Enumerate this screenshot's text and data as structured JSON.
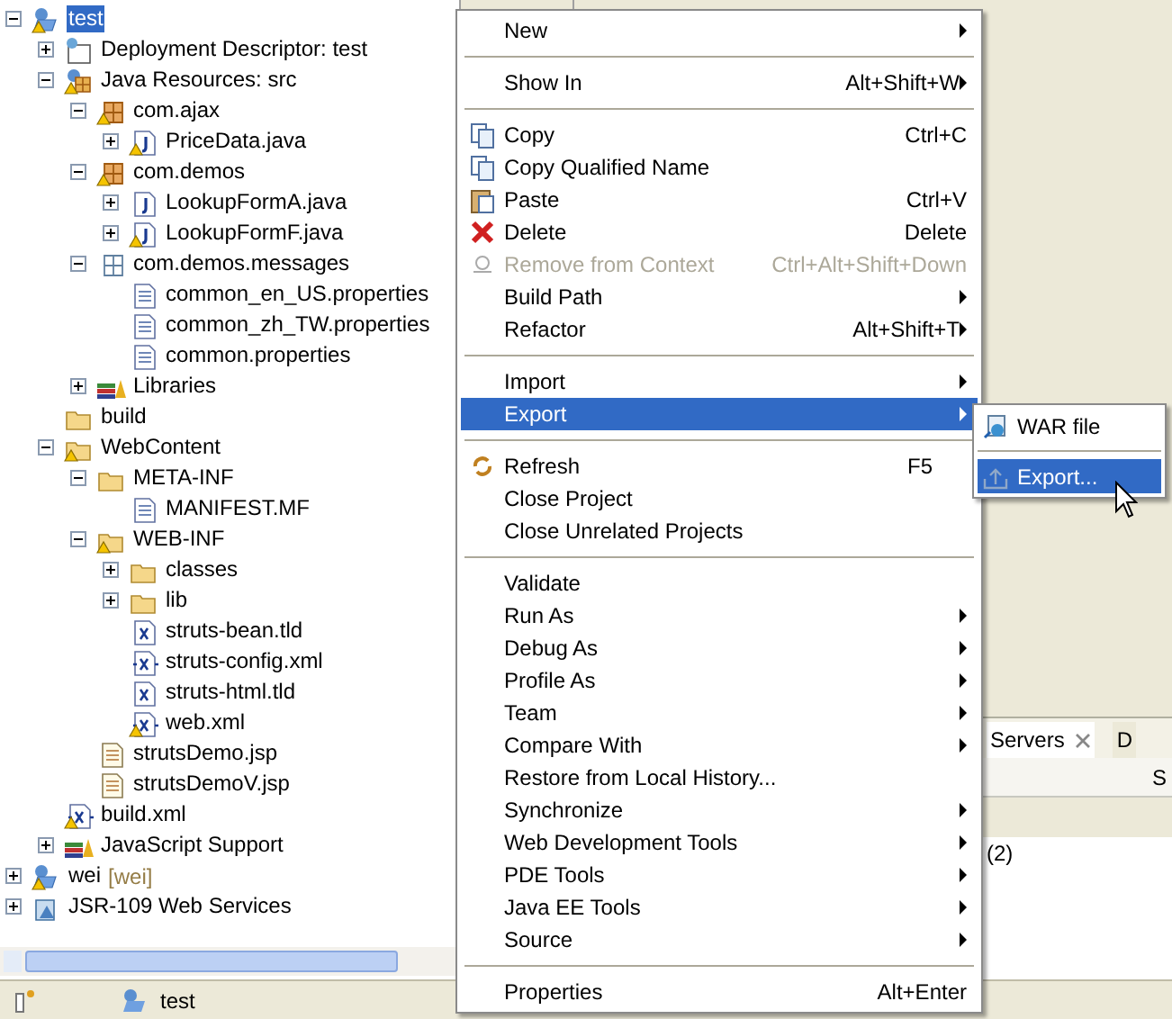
{
  "tree": [
    {
      "label": "test",
      "kind": "project",
      "warning": true,
      "selected": true,
      "expanded": true,
      "children": [
        {
          "label": "Deployment Descriptor: test",
          "kind": "descriptor",
          "warning": false,
          "selected": false,
          "expanded": false
        },
        {
          "label": "Java Resources: src",
          "kind": "java-resources",
          "warning": true,
          "selected": false,
          "expanded": true,
          "children": [
            {
              "label": "com.ajax",
              "kind": "package",
              "warning": true,
              "selected": false,
              "expanded": true,
              "children": [
                {
                  "label": "PriceData.java",
                  "kind": "java-file",
                  "warning": true,
                  "selected": false,
                  "expanded": false
                }
              ]
            },
            {
              "label": "com.demos",
              "kind": "package",
              "warning": true,
              "selected": false,
              "expanded": true,
              "children": [
                {
                  "label": "LookupFormA.java",
                  "kind": "java-file",
                  "warning": false,
                  "selected": false,
                  "expanded": false
                },
                {
                  "label": "LookupFormF.java",
                  "kind": "java-file",
                  "warning": true,
                  "selected": false,
                  "expanded": false
                }
              ]
            },
            {
              "label": "com.demos.messages",
              "kind": "empty-package",
              "warning": false,
              "selected": false,
              "expanded": true,
              "children": [
                {
                  "label": "common_en_US.properties",
                  "kind": "text-file",
                  "warning": false,
                  "selected": false
                },
                {
                  "label": "common_zh_TW.properties",
                  "kind": "text-file",
                  "warning": false,
                  "selected": false
                },
                {
                  "label": "common.properties",
                  "kind": "text-file",
                  "warning": false,
                  "selected": false
                }
              ]
            },
            {
              "label": "Libraries",
              "kind": "library",
              "warning": false,
              "selected": false,
              "expanded": false
            }
          ]
        },
        {
          "label": "build",
          "kind": "folder",
          "warning": false,
          "selected": false
        },
        {
          "label": "WebContent",
          "kind": "folder",
          "warning": true,
          "selected": false,
          "expanded": true,
          "children": [
            {
              "label": "META-INF",
              "kind": "folder",
              "warning": false,
              "selected": false,
              "expanded": true,
              "children": [
                {
                  "label": "MANIFEST.MF",
                  "kind": "text-file",
                  "warning": false,
                  "selected": false
                }
              ]
            },
            {
              "label": "WEB-INF",
              "kind": "folder",
              "warning": true,
              "selected": false,
              "expanded": true,
              "children": [
                {
                  "label": "classes",
                  "kind": "folder",
                  "warning": false,
                  "selected": false,
                  "expanded": false
                },
                {
                  "label": "lib",
                  "kind": "folder",
                  "warning": false,
                  "selected": false,
                  "expanded": false
                },
                {
                  "label": "struts-bean.tld",
                  "kind": "tld-file",
                  "warning": false,
                  "selected": false
                },
                {
                  "label": "struts-config.xml",
                  "kind": "xml-file",
                  "warning": false,
                  "selected": false
                },
                {
                  "label": "struts-html.tld",
                  "kind": "tld-file",
                  "warning": false,
                  "selected": false
                },
                {
                  "label": "web.xml",
                  "kind": "xml-file",
                  "warning": true,
                  "selected": false
                }
              ]
            },
            {
              "label": "strutsDemo.jsp",
              "kind": "jsp-file",
              "warning": false,
              "selected": false
            },
            {
              "label": "strutsDemoV.jsp",
              "kind": "jsp-file",
              "warning": false,
              "selected": false
            }
          ]
        },
        {
          "label": "build.xml",
          "kind": "xml-file",
          "warning": true,
          "selected": false
        },
        {
          "label": "JavaScript Support",
          "kind": "library",
          "warning": false,
          "selected": false,
          "expanded": false
        }
      ]
    },
    {
      "label": "wei",
      "decoration": "[wei]",
      "kind": "project",
      "warning": true,
      "selected": false,
      "expanded": false
    },
    {
      "label": "JSR-109 Web Services",
      "kind": "web-services",
      "warning": false,
      "selected": false,
      "expanded": false
    }
  ],
  "status_bar": {
    "label": "test"
  },
  "servers_panel": {
    "tabs": [
      {
        "label": "Servers",
        "selected": true
      },
      {
        "label": "D",
        "selected": false
      }
    ],
    "column_header": "S",
    "row_text": "(2)"
  },
  "menu": [
    {
      "kind": "item",
      "label": "New",
      "submenu": true,
      "disabled": false,
      "selected": false
    },
    {
      "kind": "separator"
    },
    {
      "kind": "item",
      "label": "Show In",
      "shortcut": "Alt+Shift+W",
      "submenu": true,
      "disabled": false,
      "selected": false
    },
    {
      "kind": "separator"
    },
    {
      "kind": "copy",
      "label": "Copy",
      "shortcut": "Ctrl+C",
      "submenu": false,
      "disabled": false,
      "selected": false
    },
    {
      "kind": "copy",
      "label": "Copy Qualified Name",
      "submenu": false,
      "disabled": false,
      "selected": false
    },
    {
      "kind": "paste",
      "label": "Paste",
      "shortcut": "Ctrl+V",
      "submenu": false,
      "disabled": false,
      "selected": false
    },
    {
      "kind": "delete",
      "label": "Delete",
      "shortcut": "Delete",
      "submenu": false,
      "disabled": false,
      "selected": false
    },
    {
      "kind": "remove",
      "label": "Remove from Context",
      "shortcut": "Ctrl+Alt+Shift+Down",
      "submenu": false,
      "disabled": true,
      "selected": false
    },
    {
      "kind": "item",
      "label": "Build Path",
      "submenu": true,
      "disabled": false,
      "selected": false
    },
    {
      "kind": "item",
      "label": "Refactor",
      "shortcut": "Alt+Shift+T",
      "submenu": true,
      "disabled": false,
      "selected": false
    },
    {
      "kind": "separator"
    },
    {
      "kind": "item",
      "label": "Import",
      "submenu": true,
      "disabled": false,
      "selected": false
    },
    {
      "kind": "item",
      "label": "Export",
      "submenu": true,
      "disabled": false,
      "selected": true
    },
    {
      "kind": "separator"
    },
    {
      "kind": "refresh",
      "label": "Refresh",
      "shortcut": "F5",
      "submenu": false,
      "disabled": false,
      "selected": false
    },
    {
      "kind": "item",
      "label": "Close Project",
      "submenu": false,
      "disabled": false,
      "selected": false
    },
    {
      "kind": "item",
      "label": "Close Unrelated Projects",
      "submenu": false,
      "disabled": false,
      "selected": false
    },
    {
      "kind": "separator"
    },
    {
      "kind": "item",
      "label": "Validate",
      "submenu": false,
      "disabled": false,
      "selected": false
    },
    {
      "kind": "item",
      "label": "Run As",
      "submenu": true,
      "disabled": false,
      "selected": false
    },
    {
      "kind": "item",
      "label": "Debug As",
      "submenu": true,
      "disabled": false,
      "selected": false
    },
    {
      "kind": "item",
      "label": "Profile As",
      "submenu": true,
      "disabled": false,
      "selected": false
    },
    {
      "kind": "item",
      "label": "Team",
      "submenu": true,
      "disabled": false,
      "selected": false
    },
    {
      "kind": "item",
      "label": "Compare With",
      "submenu": true,
      "disabled": false,
      "selected": false
    },
    {
      "kind": "item",
      "label": "Restore from Local History...",
      "submenu": false,
      "disabled": false,
      "selected": false
    },
    {
      "kind": "item",
      "label": "Synchronize",
      "submenu": true,
      "disabled": false,
      "selected": false
    },
    {
      "kind": "item",
      "label": "Web Development Tools",
      "submenu": true,
      "disabled": false,
      "selected": false
    },
    {
      "kind": "item",
      "label": "PDE Tools",
      "submenu": true,
      "disabled": false,
      "selected": false
    },
    {
      "kind": "item",
      "label": "Java EE Tools",
      "submenu": true,
      "disabled": false,
      "selected": false
    },
    {
      "kind": "item",
      "label": "Source",
      "submenu": true,
      "disabled": false,
      "selected": false
    },
    {
      "kind": "separator"
    },
    {
      "kind": "item",
      "label": "Properties",
      "shortcut": "Alt+Enter",
      "submenu": false,
      "disabled": false,
      "selected": false
    }
  ],
  "submenu": [
    {
      "kind": "war",
      "label": "WAR file",
      "selected": false
    },
    {
      "kind": "separator"
    },
    {
      "kind": "export",
      "label": "Export...",
      "selected": true
    }
  ]
}
